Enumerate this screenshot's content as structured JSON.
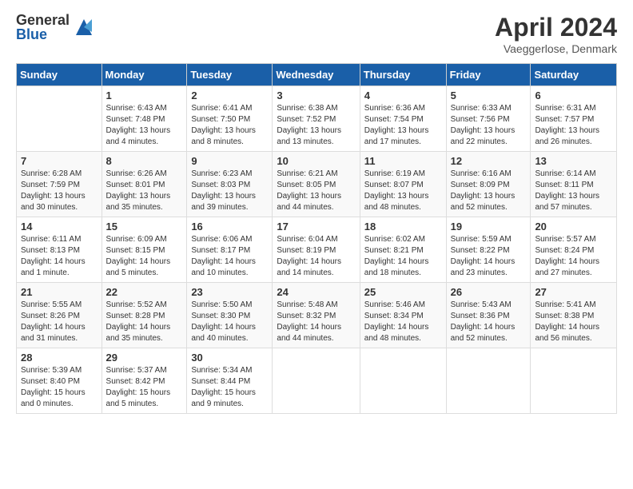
{
  "header": {
    "logo_general": "General",
    "logo_blue": "Blue",
    "month": "April 2024",
    "location": "Vaeggerlose, Denmark"
  },
  "columns": [
    "Sunday",
    "Monday",
    "Tuesday",
    "Wednesday",
    "Thursday",
    "Friday",
    "Saturday"
  ],
  "weeks": [
    [
      {
        "num": "",
        "sunrise": "",
        "sunset": "",
        "daylight": ""
      },
      {
        "num": "1",
        "sunrise": "Sunrise: 6:43 AM",
        "sunset": "Sunset: 7:48 PM",
        "daylight": "Daylight: 13 hours and 4 minutes."
      },
      {
        "num": "2",
        "sunrise": "Sunrise: 6:41 AM",
        "sunset": "Sunset: 7:50 PM",
        "daylight": "Daylight: 13 hours and 8 minutes."
      },
      {
        "num": "3",
        "sunrise": "Sunrise: 6:38 AM",
        "sunset": "Sunset: 7:52 PM",
        "daylight": "Daylight: 13 hours and 13 minutes."
      },
      {
        "num": "4",
        "sunrise": "Sunrise: 6:36 AM",
        "sunset": "Sunset: 7:54 PM",
        "daylight": "Daylight: 13 hours and 17 minutes."
      },
      {
        "num": "5",
        "sunrise": "Sunrise: 6:33 AM",
        "sunset": "Sunset: 7:56 PM",
        "daylight": "Daylight: 13 hours and 22 minutes."
      },
      {
        "num": "6",
        "sunrise": "Sunrise: 6:31 AM",
        "sunset": "Sunset: 7:57 PM",
        "daylight": "Daylight: 13 hours and 26 minutes."
      }
    ],
    [
      {
        "num": "7",
        "sunrise": "Sunrise: 6:28 AM",
        "sunset": "Sunset: 7:59 PM",
        "daylight": "Daylight: 13 hours and 30 minutes."
      },
      {
        "num": "8",
        "sunrise": "Sunrise: 6:26 AM",
        "sunset": "Sunset: 8:01 PM",
        "daylight": "Daylight: 13 hours and 35 minutes."
      },
      {
        "num": "9",
        "sunrise": "Sunrise: 6:23 AM",
        "sunset": "Sunset: 8:03 PM",
        "daylight": "Daylight: 13 hours and 39 minutes."
      },
      {
        "num": "10",
        "sunrise": "Sunrise: 6:21 AM",
        "sunset": "Sunset: 8:05 PM",
        "daylight": "Daylight: 13 hours and 44 minutes."
      },
      {
        "num": "11",
        "sunrise": "Sunrise: 6:19 AM",
        "sunset": "Sunset: 8:07 PM",
        "daylight": "Daylight: 13 hours and 48 minutes."
      },
      {
        "num": "12",
        "sunrise": "Sunrise: 6:16 AM",
        "sunset": "Sunset: 8:09 PM",
        "daylight": "Daylight: 13 hours and 52 minutes."
      },
      {
        "num": "13",
        "sunrise": "Sunrise: 6:14 AM",
        "sunset": "Sunset: 8:11 PM",
        "daylight": "Daylight: 13 hours and 57 minutes."
      }
    ],
    [
      {
        "num": "14",
        "sunrise": "Sunrise: 6:11 AM",
        "sunset": "Sunset: 8:13 PM",
        "daylight": "Daylight: 14 hours and 1 minute."
      },
      {
        "num": "15",
        "sunrise": "Sunrise: 6:09 AM",
        "sunset": "Sunset: 8:15 PM",
        "daylight": "Daylight: 14 hours and 5 minutes."
      },
      {
        "num": "16",
        "sunrise": "Sunrise: 6:06 AM",
        "sunset": "Sunset: 8:17 PM",
        "daylight": "Daylight: 14 hours and 10 minutes."
      },
      {
        "num": "17",
        "sunrise": "Sunrise: 6:04 AM",
        "sunset": "Sunset: 8:19 PM",
        "daylight": "Daylight: 14 hours and 14 minutes."
      },
      {
        "num": "18",
        "sunrise": "Sunrise: 6:02 AM",
        "sunset": "Sunset: 8:21 PM",
        "daylight": "Daylight: 14 hours and 18 minutes."
      },
      {
        "num": "19",
        "sunrise": "Sunrise: 5:59 AM",
        "sunset": "Sunset: 8:22 PM",
        "daylight": "Daylight: 14 hours and 23 minutes."
      },
      {
        "num": "20",
        "sunrise": "Sunrise: 5:57 AM",
        "sunset": "Sunset: 8:24 PM",
        "daylight": "Daylight: 14 hours and 27 minutes."
      }
    ],
    [
      {
        "num": "21",
        "sunrise": "Sunrise: 5:55 AM",
        "sunset": "Sunset: 8:26 PM",
        "daylight": "Daylight: 14 hours and 31 minutes."
      },
      {
        "num": "22",
        "sunrise": "Sunrise: 5:52 AM",
        "sunset": "Sunset: 8:28 PM",
        "daylight": "Daylight: 14 hours and 35 minutes."
      },
      {
        "num": "23",
        "sunrise": "Sunrise: 5:50 AM",
        "sunset": "Sunset: 8:30 PM",
        "daylight": "Daylight: 14 hours and 40 minutes."
      },
      {
        "num": "24",
        "sunrise": "Sunrise: 5:48 AM",
        "sunset": "Sunset: 8:32 PM",
        "daylight": "Daylight: 14 hours and 44 minutes."
      },
      {
        "num": "25",
        "sunrise": "Sunrise: 5:46 AM",
        "sunset": "Sunset: 8:34 PM",
        "daylight": "Daylight: 14 hours and 48 minutes."
      },
      {
        "num": "26",
        "sunrise": "Sunrise: 5:43 AM",
        "sunset": "Sunset: 8:36 PM",
        "daylight": "Daylight: 14 hours and 52 minutes."
      },
      {
        "num": "27",
        "sunrise": "Sunrise: 5:41 AM",
        "sunset": "Sunset: 8:38 PM",
        "daylight": "Daylight: 14 hours and 56 minutes."
      }
    ],
    [
      {
        "num": "28",
        "sunrise": "Sunrise: 5:39 AM",
        "sunset": "Sunset: 8:40 PM",
        "daylight": "Daylight: 15 hours and 0 minutes."
      },
      {
        "num": "29",
        "sunrise": "Sunrise: 5:37 AM",
        "sunset": "Sunset: 8:42 PM",
        "daylight": "Daylight: 15 hours and 5 minutes."
      },
      {
        "num": "30",
        "sunrise": "Sunrise: 5:34 AM",
        "sunset": "Sunset: 8:44 PM",
        "daylight": "Daylight: 15 hours and 9 minutes."
      },
      {
        "num": "",
        "sunrise": "",
        "sunset": "",
        "daylight": ""
      },
      {
        "num": "",
        "sunrise": "",
        "sunset": "",
        "daylight": ""
      },
      {
        "num": "",
        "sunrise": "",
        "sunset": "",
        "daylight": ""
      },
      {
        "num": "",
        "sunrise": "",
        "sunset": "",
        "daylight": ""
      }
    ]
  ]
}
